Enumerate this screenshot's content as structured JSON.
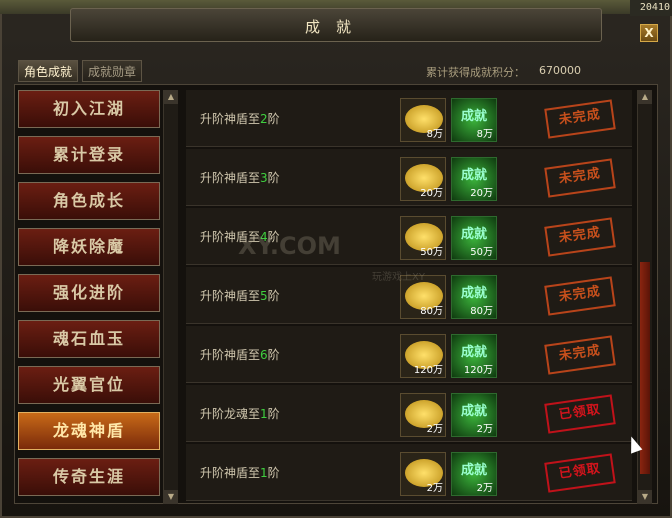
{
  "window": {
    "title": "成就",
    "close_label": "X",
    "corner_text": "20410"
  },
  "tabs": [
    {
      "label": "角色成就"
    },
    {
      "label": "成就勋章"
    }
  ],
  "score": {
    "label": "累计获得成就积分：",
    "value": "670000"
  },
  "sidebar": {
    "items": [
      {
        "label": "初入江湖"
      },
      {
        "label": "累计登录"
      },
      {
        "label": "角色成长"
      },
      {
        "label": "降妖除魔"
      },
      {
        "label": "强化进阶"
      },
      {
        "label": "魂石血玉"
      },
      {
        "label": "光翼官位"
      },
      {
        "label": "龙魂神盾"
      },
      {
        "label": "传奇生涯"
      }
    ],
    "active": "龙魂神盾"
  },
  "rows": [
    {
      "prefix": "升阶神盾至",
      "level": "2",
      "suffix": "阶",
      "coin": "8万",
      "ach_label": "成就",
      "ach": "8万",
      "status": "未完成"
    },
    {
      "prefix": "升阶神盾至",
      "level": "3",
      "suffix": "阶",
      "coin": "20万",
      "ach_label": "成就",
      "ach": "20万",
      "status": "未完成"
    },
    {
      "prefix": "升阶神盾至",
      "level": "4",
      "suffix": "阶",
      "coin": "50万",
      "ach_label": "成就",
      "ach": "50万",
      "status": "未完成"
    },
    {
      "prefix": "升阶神盾至",
      "level": "5",
      "suffix": "阶",
      "coin": "80万",
      "ach_label": "成就",
      "ach": "80万",
      "status": "未完成"
    },
    {
      "prefix": "升阶神盾至",
      "level": "6",
      "suffix": "阶",
      "coin": "120万",
      "ach_label": "成就",
      "ach": "120万",
      "status": "未完成"
    },
    {
      "prefix": "升阶龙魂至",
      "level": "1",
      "suffix": "阶",
      "coin": "2万",
      "ach_label": "成就",
      "ach": "2万",
      "status": "已领取"
    },
    {
      "prefix": "升阶神盾至",
      "level": "1",
      "suffix": "阶",
      "coin": "2万",
      "ach_label": "成就",
      "ach": "2万",
      "status": "已领取"
    }
  ],
  "watermark": {
    "main": "XY.COM",
    "sub": "玩游戏上XY"
  },
  "colors": {
    "level": "#3fcf3f",
    "incomplete": "#c8501c",
    "claimed": "#d4141c",
    "active_tab": "#c86a18"
  }
}
